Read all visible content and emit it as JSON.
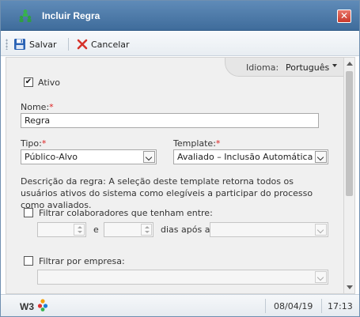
{
  "window": {
    "title": "Incluir Regra",
    "close_label": "✕"
  },
  "toolbar": {
    "save_label": "Salvar",
    "cancel_label": "Cancelar"
  },
  "language": {
    "label": "Idioma:",
    "value": "Português"
  },
  "form": {
    "ativo": {
      "label": "Ativo",
      "checked": true
    },
    "nome": {
      "label": "Nome:",
      "required": "*",
      "value": "Regra"
    },
    "tipo": {
      "label": "Tipo:",
      "required": "*",
      "value": "Público-Alvo"
    },
    "template": {
      "label": "Template:",
      "required": "*",
      "value": "Avaliado – Inclusão Automática"
    },
    "description": "Descrição da regra: A seleção deste template retorna todos os usuários ativos do sistema como elegíveis a participar do processo como avaliados.",
    "filter_collab": {
      "label": "Filtrar colaboradores que tenham entre:",
      "and_label": "e",
      "days_after_label": "dias após a"
    },
    "filter_company": {
      "label": "Filtrar por empresa:"
    }
  },
  "status": {
    "logo": "W3",
    "date": "08/04/19",
    "time": "17:13"
  },
  "colors": {
    "titlebar": "#4f7dad",
    "required": "#dd2222",
    "close": "#d9493b"
  }
}
